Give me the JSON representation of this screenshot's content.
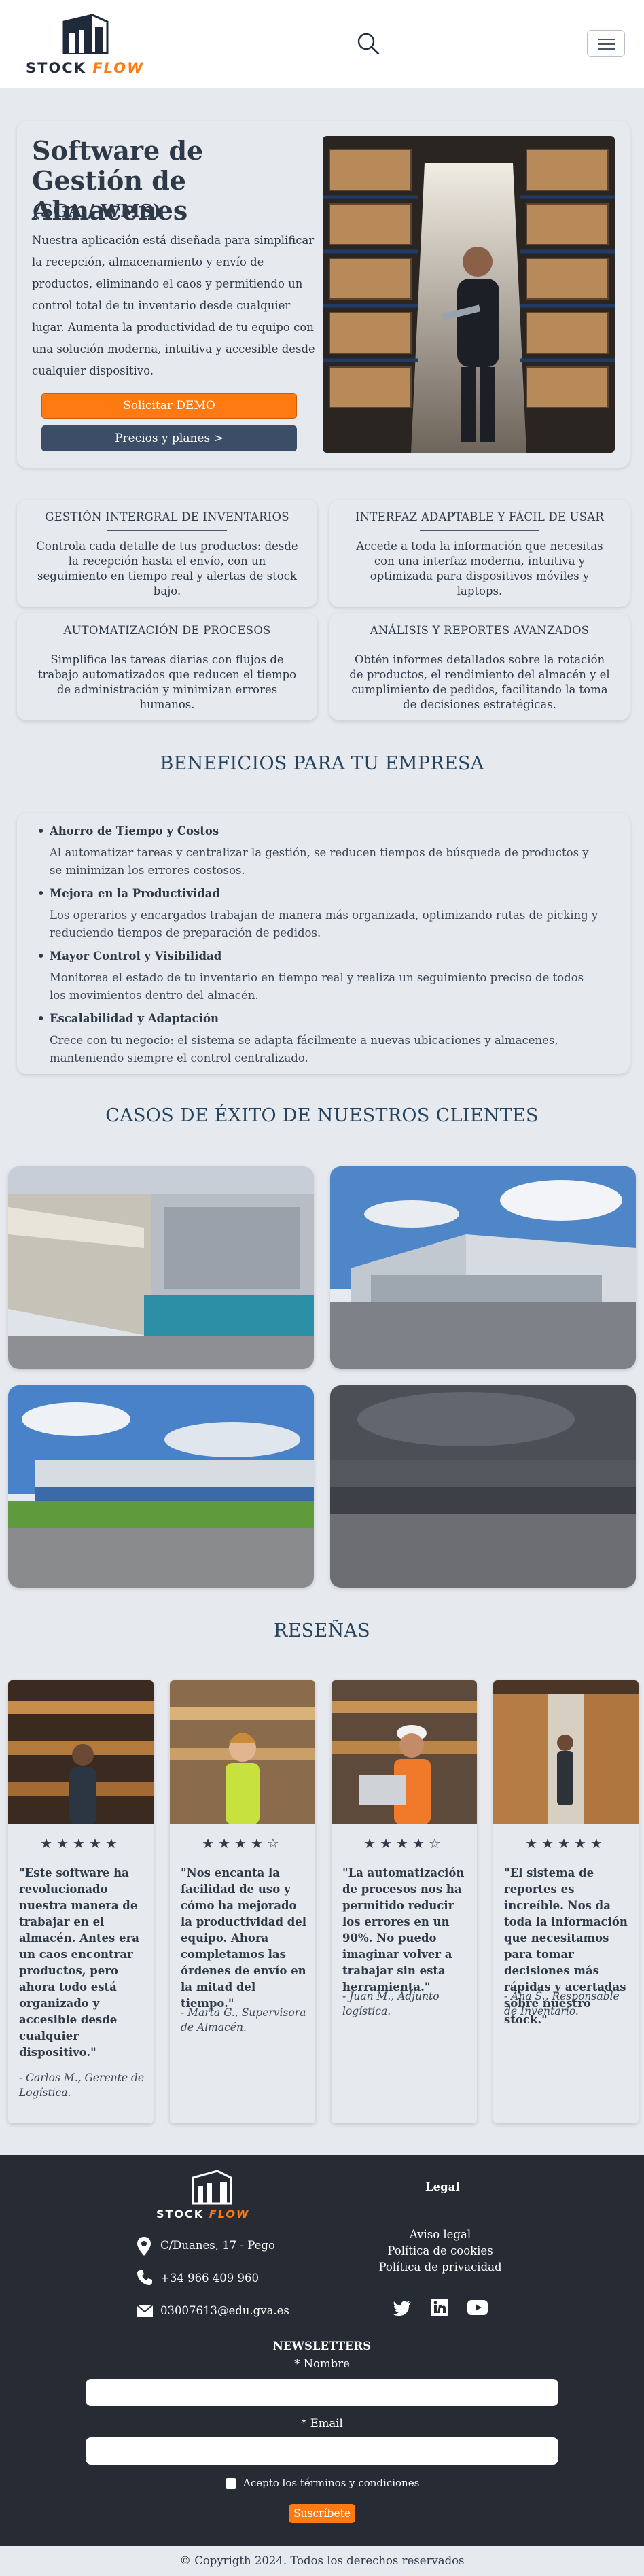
{
  "header": {
    "logo_stock": "STOCK",
    "logo_flow": "FLOW",
    "search_icon": "search-icon",
    "menu_icon": "hamburger-icon"
  },
  "hero": {
    "title": "Software de Gestión de Almacenes",
    "subtitle": "(SGA / WMS)",
    "description": "Nuestra aplicación está diseñada para simplificar la recepción, almacenamiento y envío de productos, eliminando el caos y permitiendo un control total de tu inventario desde cualquier lugar. Aumenta la productividad de tu equipo con una solución moderna, intuitiva y accesible desde cualquier dispositivo.",
    "demo_button": "Solicitar DEMO",
    "prices_button": "Precios y planes >"
  },
  "features": [
    {
      "title": "GESTIÓN INTERGRAL DE INVENTARIOS",
      "text": "Controla cada detalle de tus productos: desde la recepción hasta el envío, con un seguimiento en tiempo real y alertas de stock bajo."
    },
    {
      "title": "INTERFAZ ADAPTABLE Y FÁCIL DE USAR",
      "text": "Accede a toda la información que necesitas con una interfaz moderna, intuitiva y optimizada para dispositivos móviles y laptops."
    },
    {
      "title": "AUTOMATIZACIÓN DE PROCESOS",
      "text": "Simplifica las tareas diarias con flujos de trabajo automatizados que reducen el tiempo de administración y minimizan errores humanos."
    },
    {
      "title": "ANÁLISIS Y REPORTES AVANZADOS",
      "text": "Obtén informes detallados sobre la rotación de productos, el rendimiento del almacén y el cumplimiento de pedidos, facilitando la toma de decisiones estratégicas."
    }
  ],
  "benefits": {
    "title": "BENEFICIOS PARA TU EMPRESA",
    "items": [
      {
        "title": "Ahorro de Tiempo y Costos",
        "text": "Al automatizar tareas y centralizar la gestión, se reducen tiempos de búsqueda de productos y se minimizan los errores costosos."
      },
      {
        "title": "Mejora en la Productividad",
        "text": "Los operarios y encargados trabajan de manera más organizada, optimizando rutas de picking y reduciendo tiempos de preparación de pedidos."
      },
      {
        "title": "Mayor Control y Visibilidad",
        "text": "Monitorea el estado de tu inventario en tiempo real y realiza un seguimiento preciso de todos los movimientos dentro del almacén."
      },
      {
        "title": "Escalabilidad y Adaptación",
        "text": "Crece con tu negocio: el sistema se adapta fácilmente a nuevas ubicaciones y almacenes, manteniendo siempre el control centralizado."
      }
    ]
  },
  "cases": {
    "title": "CASOS DE ÉXITO DE NUESTROS CLIENTES"
  },
  "reviews": {
    "title": "RESEÑAS",
    "items": [
      {
        "stars": "★★★★★",
        "rating": 5,
        "quote": "\"Este software ha revolucionado nuestra manera de trabajar en el almacén. Antes era un caos encontrar productos, pero ahora todo está organizado y accesible desde cualquier dispositivo.\"",
        "author": "- Carlos M., Gerente de Logística."
      },
      {
        "stars": "★★★★☆",
        "rating": 4,
        "quote": "\"Nos encanta la facilidad de uso y cómo ha mejorado la productividad del equipo. Ahora completamos las órdenes de envío en la mitad del tiempo.\"",
        "author": "- Marta G., Supervisora de Almacén."
      },
      {
        "stars": "★★★★☆",
        "rating": 4,
        "quote": "\"La automatización de procesos nos ha permitido reducir los errores en un 90%. No puedo imaginar volver a trabajar sin esta herramienta.\"",
        "author": "- Juan M., Adjunto logística."
      },
      {
        "stars": "★★★★★",
        "rating": 5,
        "quote": "\"El sistema de reportes es increíble. Nos da toda la información que necesitamos para tomar decisiones más rápidas y acertadas sobre nuestro stock.\"",
        "author": "- Ana S., Responsable de Inventario."
      }
    ]
  },
  "footer": {
    "address": "C/Duanes, 17 - Pego",
    "phone": "+34 966 409 960",
    "email": "03007613@edu.gva.es",
    "legal_title": "Legal",
    "legal_links": [
      "Aviso legal",
      "Política de cookies",
      "Política de privacidad"
    ],
    "social_icons": [
      "twitter-icon",
      "linkedin-icon",
      "youtube-icon"
    ],
    "newsletter": {
      "title": "NEWSLETTERS",
      "name_label": "* Nombre",
      "email_label": "* Email",
      "terms_label": "Acepto los términos y condiciones",
      "submit": "Suscríbete"
    },
    "copyright": "© Copyrigth 2024. Todos los derechos reservados"
  },
  "colors": {
    "accent": "#ff7a12",
    "dark": "#262b34",
    "navy": "#3b4d67",
    "panel": "#e6e9ee"
  }
}
